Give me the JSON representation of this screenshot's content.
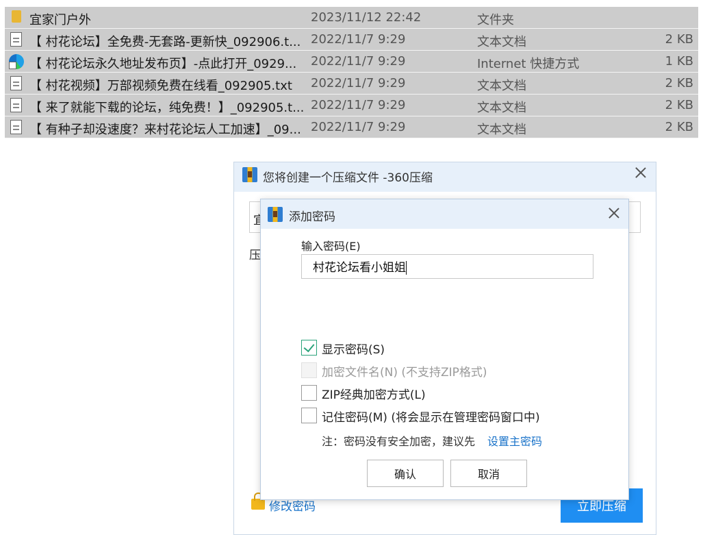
{
  "files": [
    {
      "icon": "folder-icon",
      "name": "宜家门户外",
      "date": "2023/11/12 22:42",
      "type": "文件夹",
      "size": ""
    },
    {
      "icon": "text-document-icon",
      "name": "【 村花论坛】全免费-无套路-更新快_092906.t...",
      "date": "2022/11/7 9:29",
      "type": "文本文档",
      "size": "2 KB"
    },
    {
      "icon": "edge-shortcut-icon",
      "name": "【 村花论坛永久地址发布页】-点此打开_0929...",
      "date": "2022/11/7 9:29",
      "type": "Internet 快捷方式",
      "size": "1 KB"
    },
    {
      "icon": "text-document-icon",
      "name": "【 村花视频】万部视频免费在线看_092905.txt",
      "date": "2022/11/7 9:29",
      "type": "文本文档",
      "size": "2 KB"
    },
    {
      "icon": "text-document-icon",
      "name": "【 来了就能下载的论坛，纯免费！】_092905.t...",
      "date": "2022/11/7 9:29",
      "type": "文本文档",
      "size": "2 KB"
    },
    {
      "icon": "text-document-icon",
      "name": "【 有种子却没速度？来村花论坛人工加速】_09...",
      "date": "2022/11/7 9:29",
      "type": "文本文档",
      "size": "2 KB"
    }
  ],
  "outer_dialog": {
    "title": "您将创建一个压缩文件 -360压缩",
    "path_value": "宜",
    "mode_label": "压",
    "change_password_link": "修改密码",
    "compress_now_button": "立即压缩"
  },
  "inner_dialog": {
    "title": "添加密码",
    "password_label": "输入密码(E)",
    "password_value": "村花论坛看小姐姐",
    "options": [
      {
        "label": "显示密码(S)",
        "checked": true,
        "enabled": true
      },
      {
        "label": "加密文件名(N) (不支持ZIP格式)",
        "checked": false,
        "enabled": false
      },
      {
        "label": "ZIP经典加密方式(L)",
        "checked": false,
        "enabled": true
      },
      {
        "label": "记住密码(M) (将会显示在管理密码窗口中)",
        "checked": false,
        "enabled": true
      }
    ],
    "note_text": "注：密码没有安全加密，建议先",
    "note_link": "设置主密码",
    "ok_button": "确认",
    "cancel_button": "取消"
  },
  "colors": {
    "selection_bg": "#cccccc",
    "title_bar_bg": "#e7f0fa",
    "primary_button": "#1f8ef2",
    "link": "#1a73c9",
    "checkbox_check": "#2aa37a"
  }
}
